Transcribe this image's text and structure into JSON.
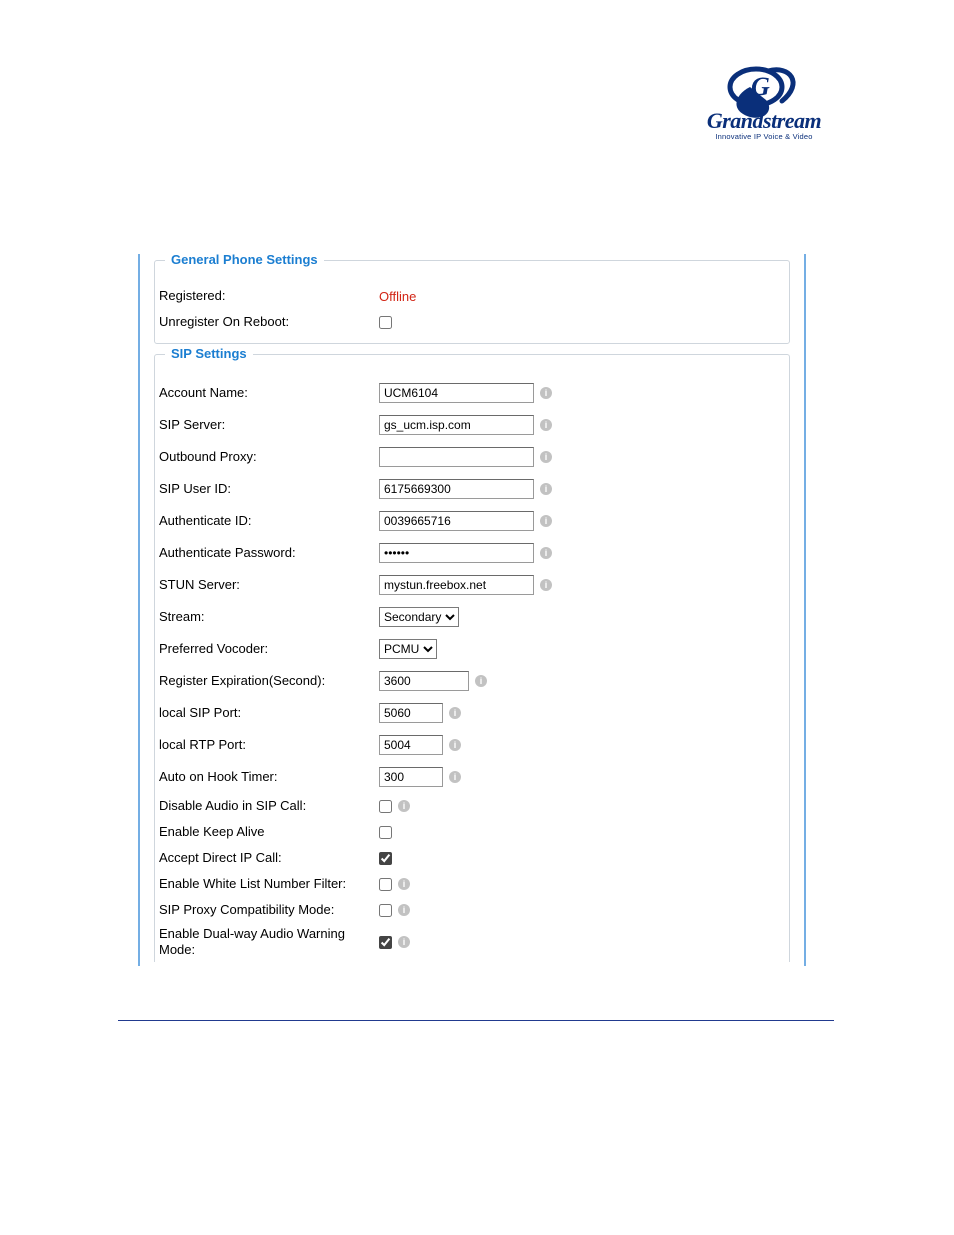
{
  "brand": {
    "name": "Grandstream",
    "tagline": "Innovative IP Voice & Video",
    "accent": "#0a2f7a"
  },
  "general": {
    "legend": "General Phone Settings",
    "registered_label": "Registered:",
    "registered_value": "Offline",
    "unregister_label": "Unregister On Reboot:",
    "unregister_checked": false
  },
  "sip": {
    "legend": "SIP Settings",
    "account_name_label": "Account Name:",
    "account_name": "UCM6104",
    "sip_server_label": "SIP Server:",
    "sip_server": "gs_ucm.isp.com",
    "outbound_proxy_label": "Outbound Proxy:",
    "outbound_proxy": "",
    "sip_user_id_label": "SIP User ID:",
    "sip_user_id": "6175669300",
    "auth_id_label": "Authenticate ID:",
    "auth_id": "0039665716",
    "auth_pw_label": "Authenticate Password:",
    "auth_pw": "••••••",
    "stun_label": "STUN Server:",
    "stun": "mystun.freebox.net",
    "stream_label": "Stream:",
    "stream": "Secondary",
    "vocoder_label": "Preferred Vocoder:",
    "vocoder": "PCMU",
    "reg_exp_label": "Register Expiration(Second):",
    "reg_exp": "3600",
    "local_sip_port_label": "local SIP Port:",
    "local_sip_port": "5060",
    "local_rtp_port_label": "local RTP Port:",
    "local_rtp_port": "5004",
    "auto_hook_label": "Auto on Hook Timer:",
    "auto_hook": "300",
    "disable_audio_label": "Disable Audio in SIP Call:",
    "disable_audio_checked": false,
    "keep_alive_label": "Enable Keep Alive",
    "keep_alive_checked": false,
    "accept_direct_ip_label": "Accept Direct IP Call:",
    "accept_direct_ip_checked": true,
    "whitelist_label": "Enable White List Number Filter:",
    "whitelist_checked": false,
    "proxy_compat_label": "SIP Proxy Compatibility Mode:",
    "proxy_compat_checked": false,
    "dual_audio_label": "Enable Dual-way Audio Warning Mode:",
    "dual_audio_checked": true
  }
}
